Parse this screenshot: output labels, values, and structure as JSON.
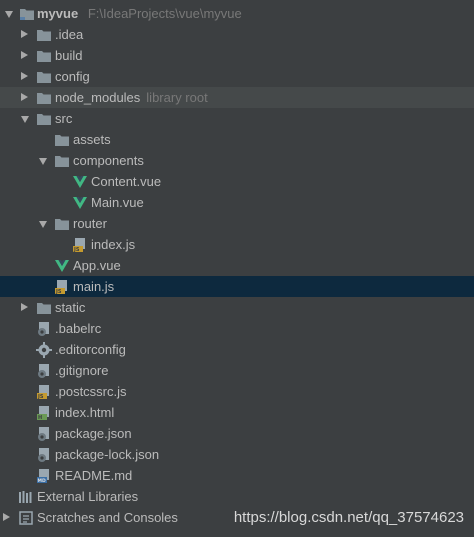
{
  "project": {
    "name": "myvue",
    "path": "F:\\IdeaProjects\\vue\\myvue"
  },
  "tree": {
    "idea": ".idea",
    "build": "build",
    "config": "config",
    "node_modules": {
      "name": "node_modules",
      "hint": "library root"
    },
    "src": "src",
    "assets": "assets",
    "components": "components",
    "content_vue": "Content.vue",
    "main_vue": "Main.vue",
    "router": "router",
    "index_js": "index.js",
    "app_vue": "App.vue",
    "main_js": "main.js",
    "static": "static",
    "babelrc": ".babelrc",
    "editorconfig": ".editorconfig",
    "gitignore": ".gitignore",
    "postcssrc": ".postcssrc.js",
    "index_html": "index.html",
    "package_json": "package.json",
    "package_lock": "package-lock.json",
    "readme": "README.md",
    "external_libraries": "External Libraries",
    "scratches": "Scratches and Consoles"
  },
  "watermark": "https://blog.csdn.net/qq_37574623",
  "colors": {
    "background": "#3c3f41",
    "selected_row": "#0d293e",
    "library_row": "#45494a",
    "folder": "#87939a",
    "vue_green": "#41b883",
    "js_badge": "#c49a2f"
  }
}
